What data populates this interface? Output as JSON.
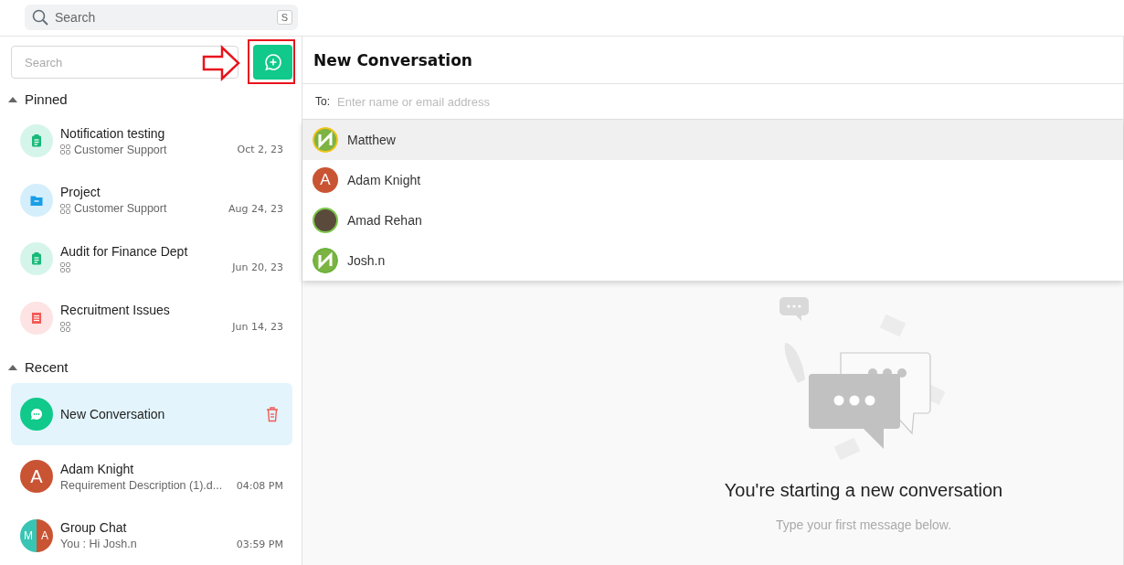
{
  "top_search": {
    "placeholder": "Search",
    "shortcut": "S"
  },
  "sidebar": {
    "search": {
      "placeholder": "Search"
    },
    "sections": [
      {
        "title": "Pinned",
        "expanded": true,
        "items": [
          {
            "kind": "task",
            "title": "Notification testing",
            "subtitle": "Customer Support",
            "time": "Oct 2, 23",
            "selected": false
          },
          {
            "kind": "folder",
            "title": "Project",
            "subtitle": "Customer Support",
            "time": "Aug 24, 23",
            "selected": false
          },
          {
            "kind": "task",
            "title": "Audit for Finance Dept",
            "time": "Jun 20, 23",
            "selected": false
          },
          {
            "kind": "receipt",
            "title": "Recruitment Issues",
            "time": "Jun 14, 23",
            "selected": false
          }
        ]
      },
      {
        "title": "Recent",
        "expanded": true,
        "items": [
          {
            "kind": "chat",
            "title": "New Conversation",
            "selected": true
          },
          {
            "kind": "initial",
            "initials": [
              "A"
            ],
            "title": "Adam Knight",
            "subtitle": "Requirement Description (1).d...",
            "time": "04:08 PM",
            "selected": false
          },
          {
            "kind": "group",
            "initials": [
              "M",
              "A"
            ],
            "title": "Group Chat",
            "subtitle": "You : Hi Josh.n",
            "time": "03:59 PM",
            "selected": false
          }
        ]
      }
    ]
  },
  "main": {
    "title": "New Conversation",
    "to_label": "To:",
    "to_placeholder": "Enter name or email address",
    "suggestions": [
      {
        "kind": "logo",
        "name": "Matthew",
        "selected": true
      },
      {
        "kind": "initial",
        "initial": "A",
        "name": "Adam Knight",
        "selected": false
      },
      {
        "kind": "photo",
        "name": "Amad Rehan",
        "selected": false
      },
      {
        "kind": "logo-green",
        "name": "Josh.n",
        "selected": false
      }
    ],
    "empty_state": {
      "heading": "You're starting a new conversation",
      "hint": "Type your first message below."
    }
  }
}
